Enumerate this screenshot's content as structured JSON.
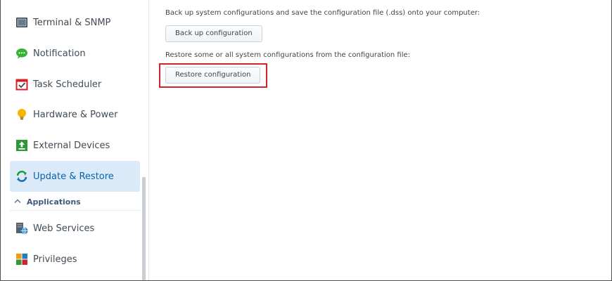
{
  "sidebar": {
    "items": [
      {
        "label": "Terminal & SNMP",
        "icon": "terminal-icon"
      },
      {
        "label": "Notification",
        "icon": "notification-bubble-icon"
      },
      {
        "label": "Task Scheduler",
        "icon": "calendar-check-icon"
      },
      {
        "label": "Hardware & Power",
        "icon": "lightbulb-icon"
      },
      {
        "label": "External Devices",
        "icon": "external-device-upload-icon"
      },
      {
        "label": "Update & Restore",
        "icon": "update-refresh-icon",
        "active": true
      },
      {
        "label": "Web Services",
        "icon": "web-services-globe-icon"
      },
      {
        "label": "Privileges",
        "icon": "privileges-blocks-icon"
      }
    ],
    "section_applications": "Applications",
    "section_chevron_icon": "chevron-up-icon"
  },
  "main": {
    "backup_description": "Back up system configurations and save the configuration file (.dss) onto your computer:",
    "backup_button": "Back up configuration",
    "restore_description": "Restore some or all system configurations from the configuration file:",
    "restore_button": "Restore configuration"
  },
  "colors": {
    "active_bg": "#dbeaf8",
    "active_text": "#0a63ad",
    "highlight_border": "#d6232a"
  }
}
